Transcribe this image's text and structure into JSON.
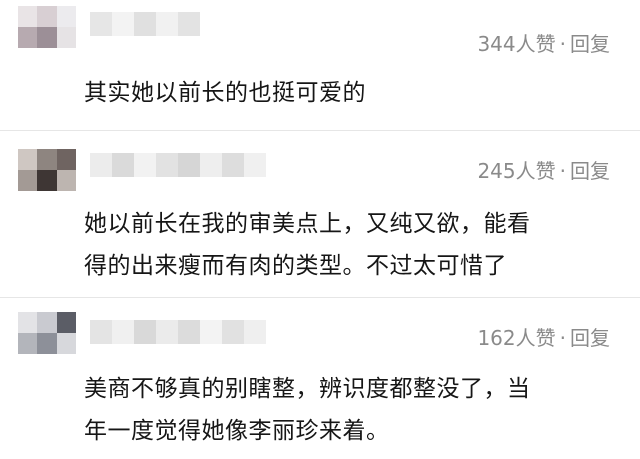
{
  "comments": [
    {
      "likes": "344人赞",
      "reply_label": "回复",
      "text_lines": [
        "其实她以前长的也挺可爱的"
      ]
    },
    {
      "likes": "245人赞",
      "reply_label": "回复",
      "text_lines": [
        "她以前长在我的审美点上，又纯又欲，能看",
        "得的出来瘦而有肉的类型。不过太可惜了"
      ]
    },
    {
      "likes": "162人赞",
      "reply_label": "回复",
      "text_lines": [
        "美商不够真的别瞎整，辨识度都整没了，当",
        "年一度觉得她像李丽珍来着。"
      ]
    }
  ],
  "separator": "·"
}
